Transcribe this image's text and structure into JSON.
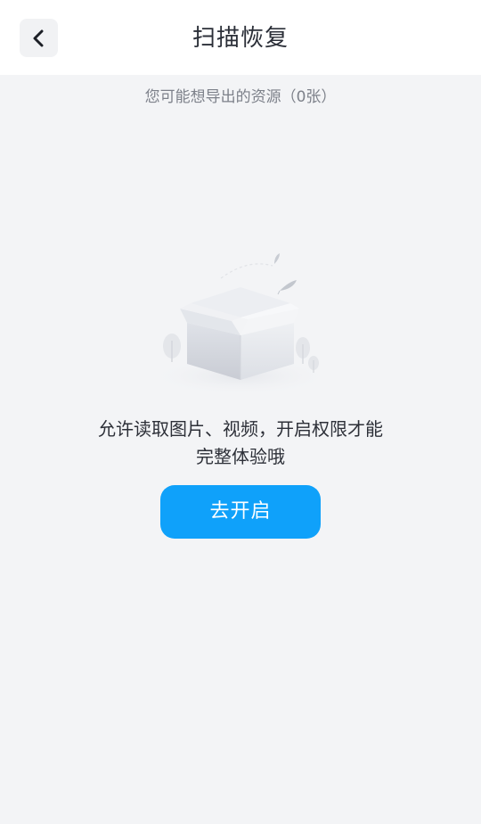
{
  "header": {
    "title": "扫描恢复",
    "back_icon": "chevron-left-icon"
  },
  "subtitle": "您可能想导出的资源（0张）",
  "empty_state": {
    "illustration": "empty-box-illustration",
    "message_line1": "允许读取图片、视频，开启权限才能",
    "message_line2": "完整体验哦"
  },
  "action": {
    "open_label": "去开启"
  },
  "colors": {
    "accent": "#0fa1fa",
    "background": "#f3f4f6",
    "header_bg": "#ffffff"
  }
}
